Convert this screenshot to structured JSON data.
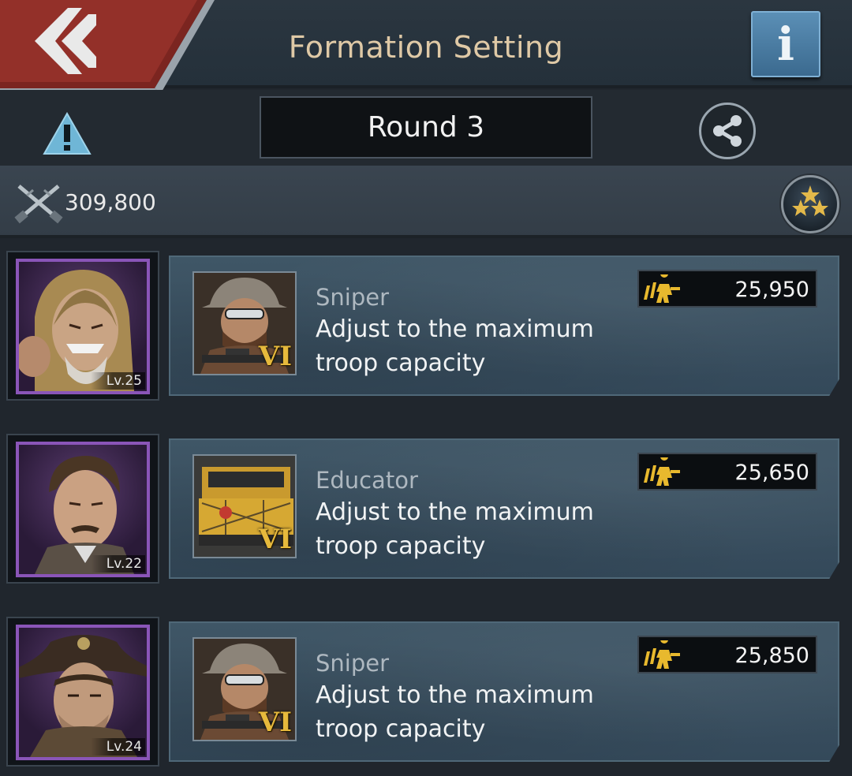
{
  "header": {
    "title": "Formation Setting",
    "back_icon": "back-chevron-icon",
    "info_label": "i"
  },
  "toolbar": {
    "round_label": "Round 3",
    "warning_icon": "warning-icon",
    "share_icon": "share-icon"
  },
  "summary": {
    "power_icon": "crossed-rifles-icon",
    "power_value": "309,800",
    "rank_icon": "stars-badge-icon"
  },
  "formation": [
    {
      "hero_level": "Lv.25",
      "unit_tier": "VI",
      "unit_type": "Sniper",
      "adjust_text": "Adjust to the maximum troop capacity",
      "troop_count": "25,950"
    },
    {
      "hero_level": "Lv.22",
      "unit_tier": "VI",
      "unit_type": "Educator",
      "adjust_text": "Adjust to the maximum troop capacity",
      "troop_count": "25,650"
    },
    {
      "hero_level": "Lv.24",
      "unit_tier": "VI",
      "unit_type": "Sniper",
      "adjust_text": "Adjust to the maximum troop capacity",
      "troop_count": "25,850"
    }
  ],
  "colors": {
    "accent_red": "#8e2a24",
    "title_gold": "#dfc9a6",
    "info_blue": "#4a7ca3",
    "hero_frame_purple": "#8a55b8",
    "tier_gold": "#e6b93c",
    "troop_icon_yellow": "#e8b92e"
  }
}
